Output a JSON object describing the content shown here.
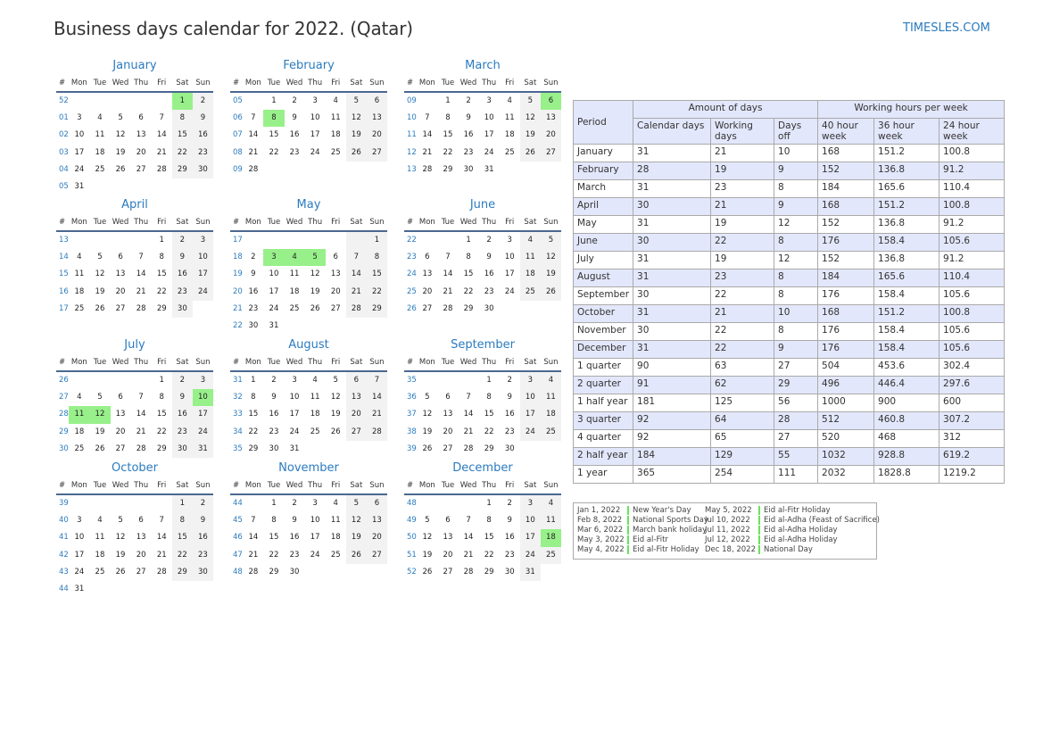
{
  "title": "Business days calendar for 2022. (Qatar)",
  "logo": "TIMESLES.COM",
  "calendar": {
    "weekday_headers": [
      "#",
      "Mon",
      "Tue",
      "Wed",
      "Thu",
      "Fri",
      "Sat",
      "Sun"
    ],
    "months": [
      {
        "name": "January",
        "weeks": [
          [
            "52",
            "",
            "",
            "",
            "",
            "",
            "1",
            "2"
          ],
          [
            "01",
            "3",
            "4",
            "5",
            "6",
            "7",
            "8",
            "9"
          ],
          [
            "02",
            "10",
            "11",
            "12",
            "13",
            "14",
            "15",
            "16"
          ],
          [
            "03",
            "17",
            "18",
            "19",
            "20",
            "21",
            "22",
            "23"
          ],
          [
            "04",
            "24",
            "25",
            "26",
            "27",
            "28",
            "29",
            "30"
          ],
          [
            "05",
            "31",
            "",
            "",
            "",
            "",
            "",
            ""
          ]
        ],
        "holidays": [
          "1"
        ]
      },
      {
        "name": "February",
        "weeks": [
          [
            "05",
            "",
            "1",
            "2",
            "3",
            "4",
            "5",
            "6"
          ],
          [
            "06",
            "7",
            "8",
            "9",
            "10",
            "11",
            "12",
            "13"
          ],
          [
            "07",
            "14",
            "15",
            "16",
            "17",
            "18",
            "19",
            "20"
          ],
          [
            "08",
            "21",
            "22",
            "23",
            "24",
            "25",
            "26",
            "27"
          ],
          [
            "09",
            "28",
            "",
            "",
            "",
            "",
            "",
            ""
          ]
        ],
        "holidays": [
          "8"
        ]
      },
      {
        "name": "March",
        "weeks": [
          [
            "09",
            "",
            "1",
            "2",
            "3",
            "4",
            "5",
            "6"
          ],
          [
            "10",
            "7",
            "8",
            "9",
            "10",
            "11",
            "12",
            "13"
          ],
          [
            "11",
            "14",
            "15",
            "16",
            "17",
            "18",
            "19",
            "20"
          ],
          [
            "12",
            "21",
            "22",
            "23",
            "24",
            "25",
            "26",
            "27"
          ],
          [
            "13",
            "28",
            "29",
            "30",
            "31",
            "",
            "",
            ""
          ]
        ],
        "holidays": [
          "6"
        ]
      },
      {
        "name": "April",
        "weeks": [
          [
            "13",
            "",
            "",
            "",
            "",
            "1",
            "2",
            "3"
          ],
          [
            "14",
            "4",
            "5",
            "6",
            "7",
            "8",
            "9",
            "10"
          ],
          [
            "15",
            "11",
            "12",
            "13",
            "14",
            "15",
            "16",
            "17"
          ],
          [
            "16",
            "18",
            "19",
            "20",
            "21",
            "22",
            "23",
            "24"
          ],
          [
            "17",
            "25",
            "26",
            "27",
            "28",
            "29",
            "30",
            ""
          ]
        ],
        "holidays": []
      },
      {
        "name": "May",
        "weeks": [
          [
            "17",
            "",
            "",
            "",
            "",
            "",
            "",
            "1"
          ],
          [
            "18",
            "2",
            "3",
            "4",
            "5",
            "6",
            "7",
            "8"
          ],
          [
            "19",
            "9",
            "10",
            "11",
            "12",
            "13",
            "14",
            "15"
          ],
          [
            "20",
            "16",
            "17",
            "18",
            "19",
            "20",
            "21",
            "22"
          ],
          [
            "21",
            "23",
            "24",
            "25",
            "26",
            "27",
            "28",
            "29"
          ],
          [
            "22",
            "30",
            "31",
            "",
            "",
            "",
            "",
            ""
          ]
        ],
        "holidays": [
          "3",
          "4",
          "5"
        ]
      },
      {
        "name": "June",
        "weeks": [
          [
            "22",
            "",
            "",
            "1",
            "2",
            "3",
            "4",
            "5"
          ],
          [
            "23",
            "6",
            "7",
            "8",
            "9",
            "10",
            "11",
            "12"
          ],
          [
            "24",
            "13",
            "14",
            "15",
            "16",
            "17",
            "18",
            "19"
          ],
          [
            "25",
            "20",
            "21",
            "22",
            "23",
            "24",
            "25",
            "26"
          ],
          [
            "26",
            "27",
            "28",
            "29",
            "30",
            "",
            "",
            ""
          ]
        ],
        "holidays": []
      },
      {
        "name": "July",
        "weeks": [
          [
            "26",
            "",
            "",
            "",
            "",
            "1",
            "2",
            "3"
          ],
          [
            "27",
            "4",
            "5",
            "6",
            "7",
            "8",
            "9",
            "10"
          ],
          [
            "28",
            "11",
            "12",
            "13",
            "14",
            "15",
            "16",
            "17"
          ],
          [
            "29",
            "18",
            "19",
            "20",
            "21",
            "22",
            "23",
            "24"
          ],
          [
            "30",
            "25",
            "26",
            "27",
            "28",
            "29",
            "30",
            "31"
          ]
        ],
        "holidays": [
          "10",
          "11",
          "12"
        ]
      },
      {
        "name": "August",
        "weeks": [
          [
            "31",
            "1",
            "2",
            "3",
            "4",
            "5",
            "6",
            "7"
          ],
          [
            "32",
            "8",
            "9",
            "10",
            "11",
            "12",
            "13",
            "14"
          ],
          [
            "33",
            "15",
            "16",
            "17",
            "18",
            "19",
            "20",
            "21"
          ],
          [
            "34",
            "22",
            "23",
            "24",
            "25",
            "26",
            "27",
            "28"
          ],
          [
            "35",
            "29",
            "30",
            "31",
            "",
            "",
            "",
            ""
          ]
        ],
        "holidays": []
      },
      {
        "name": "September",
        "weeks": [
          [
            "35",
            "",
            "",
            "",
            "1",
            "2",
            "3",
            "4"
          ],
          [
            "36",
            "5",
            "6",
            "7",
            "8",
            "9",
            "10",
            "11"
          ],
          [
            "37",
            "12",
            "13",
            "14",
            "15",
            "16",
            "17",
            "18"
          ],
          [
            "38",
            "19",
            "20",
            "21",
            "22",
            "23",
            "24",
            "25"
          ],
          [
            "39",
            "26",
            "27",
            "28",
            "29",
            "30",
            "",
            ""
          ]
        ],
        "holidays": []
      },
      {
        "name": "October",
        "weeks": [
          [
            "39",
            "",
            "",
            "",
            "",
            "",
            "1",
            "2"
          ],
          [
            "40",
            "3",
            "4",
            "5",
            "6",
            "7",
            "8",
            "9"
          ],
          [
            "41",
            "10",
            "11",
            "12",
            "13",
            "14",
            "15",
            "16"
          ],
          [
            "42",
            "17",
            "18",
            "19",
            "20",
            "21",
            "22",
            "23"
          ],
          [
            "43",
            "24",
            "25",
            "26",
            "27",
            "28",
            "29",
            "30"
          ],
          [
            "44",
            "31",
            "",
            "",
            "",
            "",
            "",
            ""
          ]
        ],
        "holidays": []
      },
      {
        "name": "November",
        "weeks": [
          [
            "44",
            "",
            "1",
            "2",
            "3",
            "4",
            "5",
            "6"
          ],
          [
            "45",
            "7",
            "8",
            "9",
            "10",
            "11",
            "12",
            "13"
          ],
          [
            "46",
            "14",
            "15",
            "16",
            "17",
            "18",
            "19",
            "20"
          ],
          [
            "47",
            "21",
            "22",
            "23",
            "24",
            "25",
            "26",
            "27"
          ],
          [
            "48",
            "28",
            "29",
            "30",
            "",
            "",
            "",
            ""
          ]
        ],
        "holidays": []
      },
      {
        "name": "December",
        "weeks": [
          [
            "48",
            "",
            "",
            "",
            "1",
            "2",
            "3",
            "4"
          ],
          [
            "49",
            "5",
            "6",
            "7",
            "8",
            "9",
            "10",
            "11"
          ],
          [
            "50",
            "12",
            "13",
            "14",
            "15",
            "16",
            "17",
            "18"
          ],
          [
            "51",
            "19",
            "20",
            "21",
            "22",
            "23",
            "24",
            "25"
          ],
          [
            "52",
            "26",
            "27",
            "28",
            "29",
            "30",
            "31",
            ""
          ]
        ],
        "holidays": [
          "18"
        ]
      }
    ]
  },
  "stats_table": {
    "header": {
      "period": "Period",
      "amount_of_days": "Amount of days",
      "working_hours": "Working hours per week",
      "columns": [
        "Calendar days",
        "Working days",
        "Days off",
        "40 hour week",
        "36 hour week",
        "24 hour week"
      ]
    },
    "rows": [
      [
        "January",
        "31",
        "21",
        "10",
        "168",
        "151.2",
        "100.8"
      ],
      [
        "February",
        "28",
        "19",
        "9",
        "152",
        "136.8",
        "91.2"
      ],
      [
        "March",
        "31",
        "23",
        "8",
        "184",
        "165.6",
        "110.4"
      ],
      [
        "April",
        "30",
        "21",
        "9",
        "168",
        "151.2",
        "100.8"
      ],
      [
        "May",
        "31",
        "19",
        "12",
        "152",
        "136.8",
        "91.2"
      ],
      [
        "June",
        "30",
        "22",
        "8",
        "176",
        "158.4",
        "105.6"
      ],
      [
        "July",
        "31",
        "19",
        "12",
        "152",
        "136.8",
        "91.2"
      ],
      [
        "August",
        "31",
        "23",
        "8",
        "184",
        "165.6",
        "110.4"
      ],
      [
        "September",
        "30",
        "22",
        "8",
        "176",
        "158.4",
        "105.6"
      ],
      [
        "October",
        "31",
        "21",
        "10",
        "168",
        "151.2",
        "100.8"
      ],
      [
        "November",
        "30",
        "22",
        "8",
        "176",
        "158.4",
        "105.6"
      ],
      [
        "December",
        "31",
        "22",
        "9",
        "176",
        "158.4",
        "105.6"
      ],
      [
        "1 quarter",
        "90",
        "63",
        "27",
        "504",
        "453.6",
        "302.4"
      ],
      [
        "2 quarter",
        "91",
        "62",
        "29",
        "496",
        "446.4",
        "297.6"
      ],
      [
        "1 half year",
        "181",
        "125",
        "56",
        "1000",
        "900",
        "600"
      ],
      [
        "3 quarter",
        "92",
        "64",
        "28",
        "512",
        "460.8",
        "307.2"
      ],
      [
        "4 quarter",
        "92",
        "65",
        "27",
        "520",
        "468",
        "312"
      ],
      [
        "2 half year",
        "184",
        "129",
        "55",
        "1032",
        "928.8",
        "619.2"
      ],
      [
        "1 year",
        "365",
        "254",
        "111",
        "2032",
        "1828.8",
        "1219.2"
      ]
    ]
  },
  "holidays_legend": [
    {
      "date": "Jan 1, 2022",
      "name": "New Year's Day"
    },
    {
      "date": "Feb 8, 2022",
      "name": "National Sports Day"
    },
    {
      "date": "Mar 6, 2022",
      "name": "March bank holiday"
    },
    {
      "date": "May 3, 2022",
      "name": "Eid al-Fitr"
    },
    {
      "date": "May 4, 2022",
      "name": "Eid al-Fitr Holiday"
    },
    {
      "date": "May 5, 2022",
      "name": "Eid al-Fitr Holiday"
    },
    {
      "date": "Jul 10, 2022",
      "name": "Eid al-Adha (Feast of Sacrifice)"
    },
    {
      "date": "Jul 11, 2022",
      "name": "Eid al-Adha Holiday"
    },
    {
      "date": "Jul 12, 2022",
      "name": "Eid al-Adha Holiday"
    },
    {
      "date": "Dec 18, 2022",
      "name": "National Day"
    }
  ],
  "colors": {
    "accent": "#2b7bbf",
    "holiday": "#98f08a",
    "weekend": "#f2f2f2",
    "table_header": "#e3e7fb"
  }
}
